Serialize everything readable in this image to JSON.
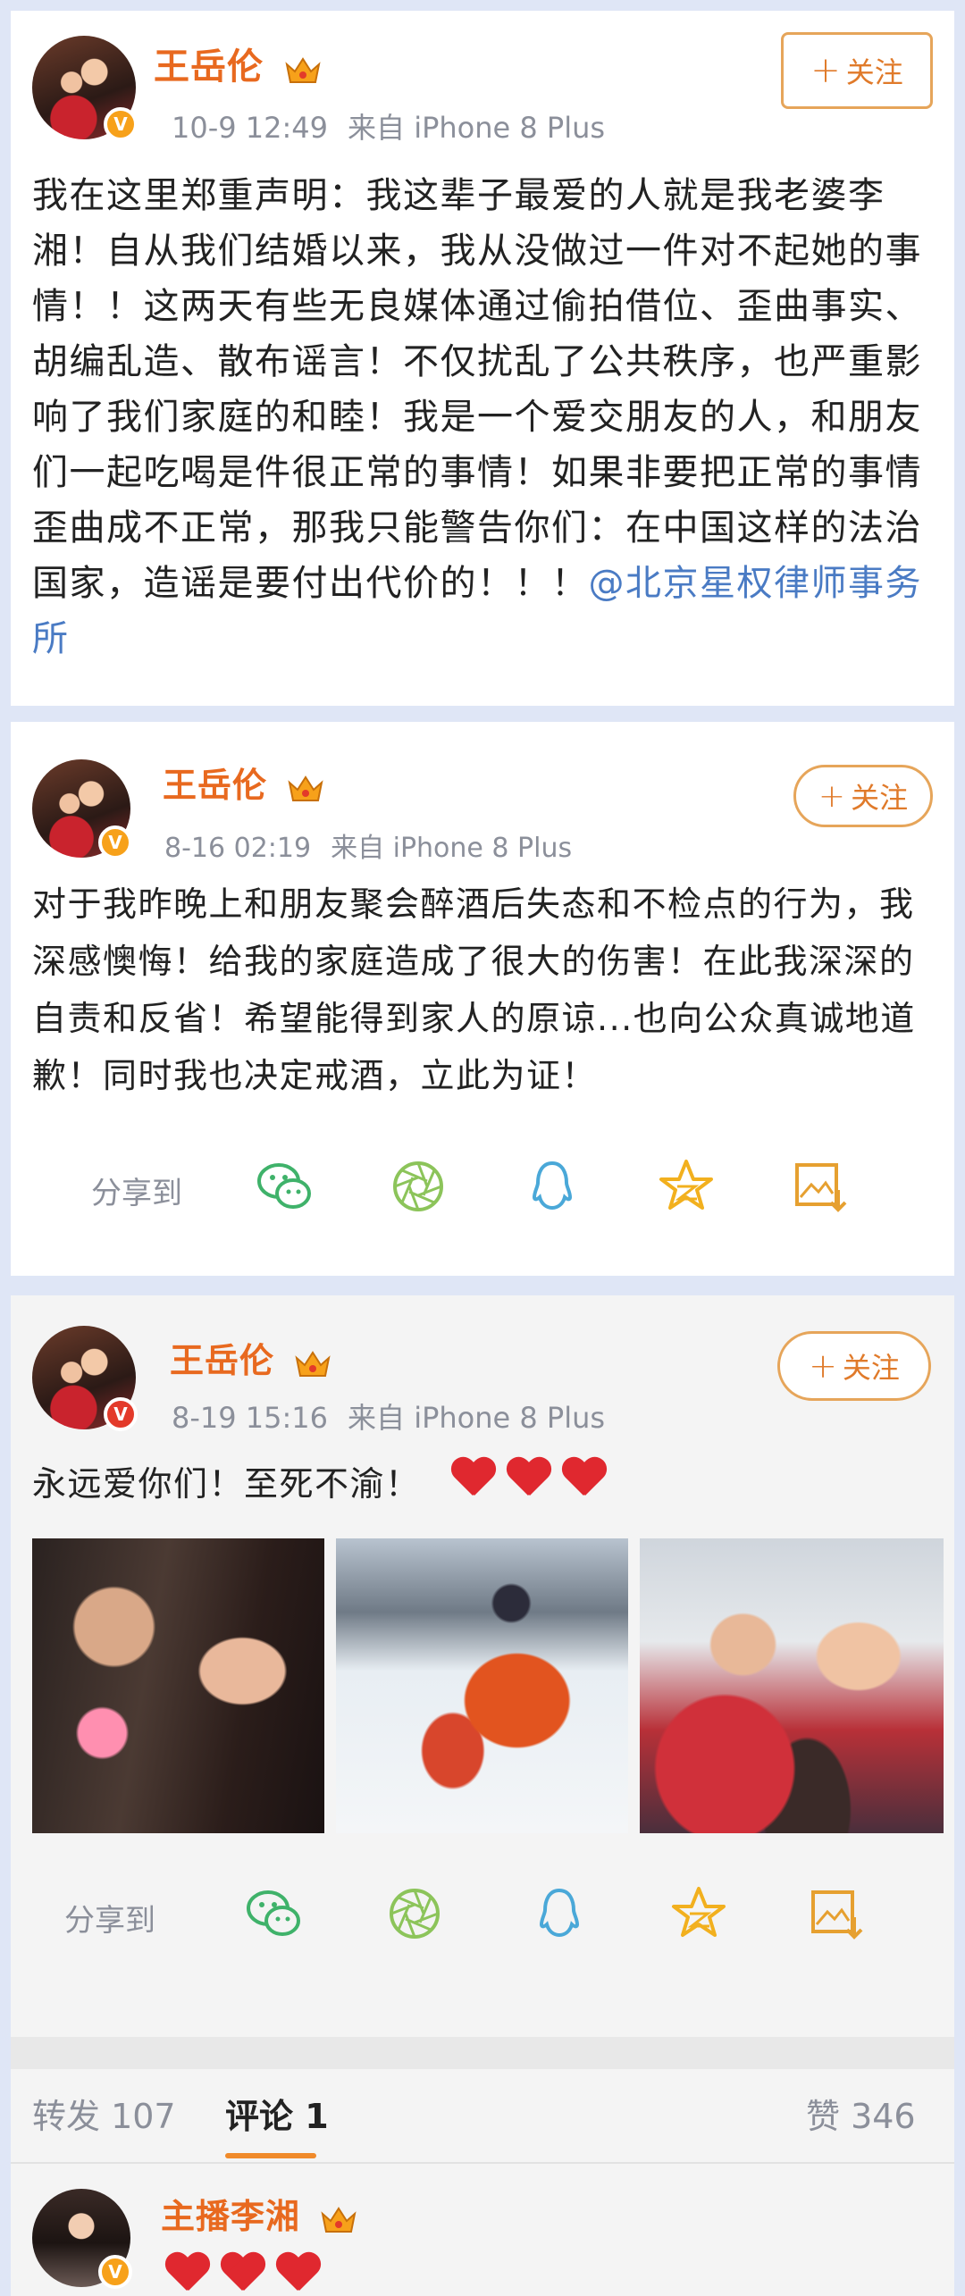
{
  "post1": {
    "username": "王岳伦",
    "time": "10-9 12:49",
    "source": "来自 iPhone 8 Plus",
    "follow_label": "关注",
    "content": "我在这里郑重声明：我这辈子最爱的人就是我老婆李湘！自从我们结婚以来，我从没做过一件对不起她的事情！！这两天有些无良媒体通过偷拍借位、歪曲事实、胡编乱造、散布谣言！不仅扰乱了公共秩序，也严重影响了我们家庭的和睦！我是一个爱交朋友的人，和朋友们一起吃喝是件很正常的事情！如果非要把正常的事情歪曲成不正常，那我只能警告你们：在中国这样的法治国家，造谣是要付出代价的！！！",
    "mention": "@北京星权律师事务所"
  },
  "post2": {
    "username": "王岳伦",
    "time": "8-16 02:19",
    "source": "来自 iPhone 8 Plus",
    "follow_label": "关注",
    "content": "对于我昨晚上和朋友聚会醉酒后失态和不检点的行为，我深感懊悔！给我的家庭造成了很大的伤害！在此我深深的自责和反省！希望能得到家人的原谅...也向公众真诚地道歉！同时我也决定戒酒，立此为证！",
    "share_label": "分享到"
  },
  "post3": {
    "username": "王岳伦",
    "time": "8-19 15:16",
    "source": "来自 iPhone 8 Plus",
    "follow_label": "关注",
    "content": "永远爱你们！至死不渝！",
    "share_label": "分享到",
    "tabs": {
      "repost": "转发 107",
      "comment": "评论 1",
      "like": "赞 346"
    },
    "comment": {
      "username": "主播李湘"
    }
  },
  "colors": {
    "username": "#e8691f",
    "meta": "#8b8f9a",
    "mention": "#4a7bc4",
    "follow_border": "#e6a55a",
    "tab_underline": "#f08a2a"
  },
  "icons": [
    "wechat-icon",
    "moments-icon",
    "qq-icon",
    "qzone-icon",
    "save-image-icon",
    "crown-icon",
    "verified-badge-icon",
    "heart-icon"
  ]
}
